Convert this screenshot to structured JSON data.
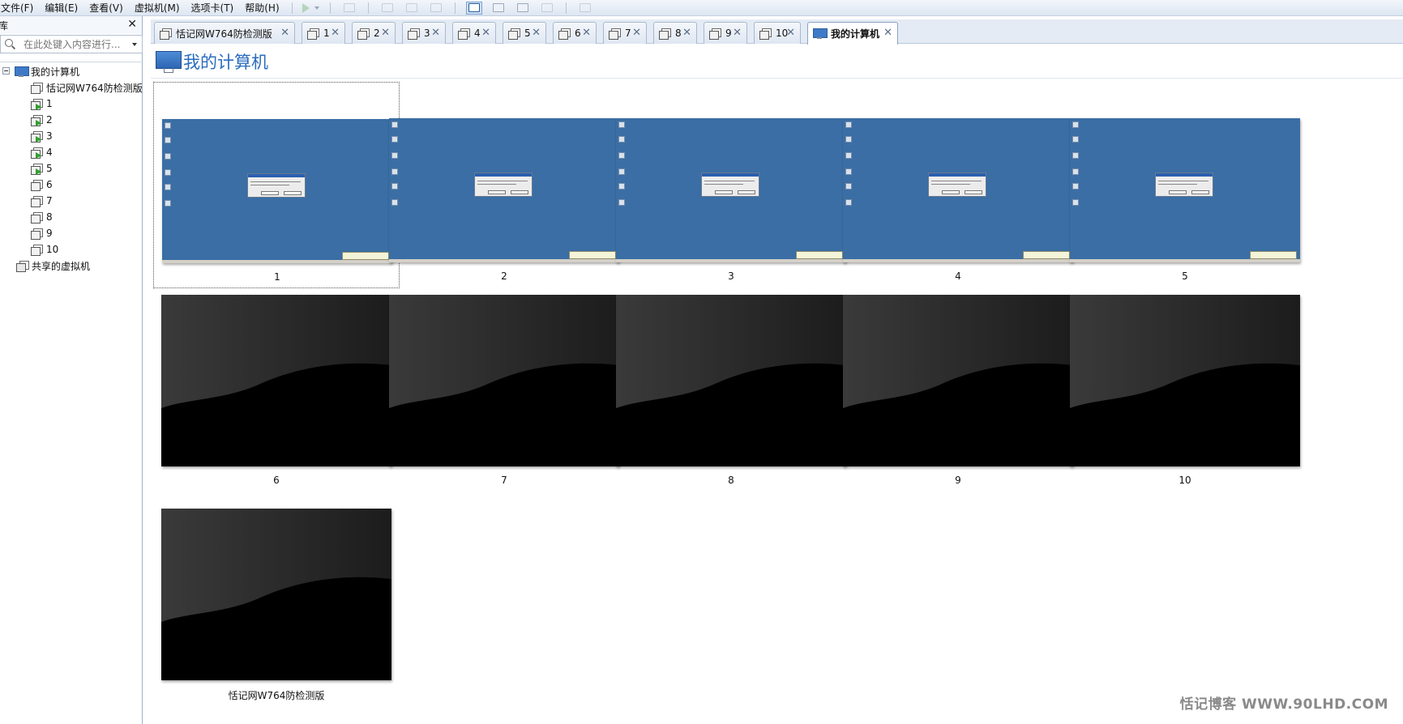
{
  "menu": [
    "文件(F)",
    "编辑(E)",
    "查看(V)",
    "虚拟机(M)",
    "选项卡(T)",
    "帮助(H)"
  ],
  "library": {
    "title": "库",
    "search_placeholder": "在此处键入内容进行...",
    "root": "我的计算机",
    "items": [
      "恬记网W764防检测版",
      "1",
      "2",
      "3",
      "4",
      "5",
      "6",
      "7",
      "8",
      "9",
      "10"
    ],
    "running": [
      false,
      true,
      true,
      true,
      true,
      true,
      false,
      false,
      false,
      false,
      false
    ],
    "shared": "共享的虚拟机"
  },
  "tabs": [
    "恬记网W764防检测版",
    "1",
    "2",
    "3",
    "4",
    "5",
    "6",
    "7",
    "8",
    "9",
    "10",
    "我的计算机"
  ],
  "page": {
    "title": "我的计算机"
  },
  "thumbnails": [
    {
      "label": "1",
      "state": "desktop"
    },
    {
      "label": "2",
      "state": "desktop"
    },
    {
      "label": "3",
      "state": "desktop"
    },
    {
      "label": "4",
      "state": "desktop"
    },
    {
      "label": "5",
      "state": "desktop"
    },
    {
      "label": "6",
      "state": "off"
    },
    {
      "label": "7",
      "state": "off"
    },
    {
      "label": "8",
      "state": "off"
    },
    {
      "label": "9",
      "state": "off"
    },
    {
      "label": "10",
      "state": "off"
    },
    {
      "label": "恬记网W764防检测版",
      "state": "off"
    }
  ],
  "watermark": "恬记博客 WWW.90LHD.COM",
  "colors": {
    "accent": "#2a6cbf",
    "desktop": "#3a6ea5",
    "off": "#000000",
    "running": "#2fa12f"
  }
}
